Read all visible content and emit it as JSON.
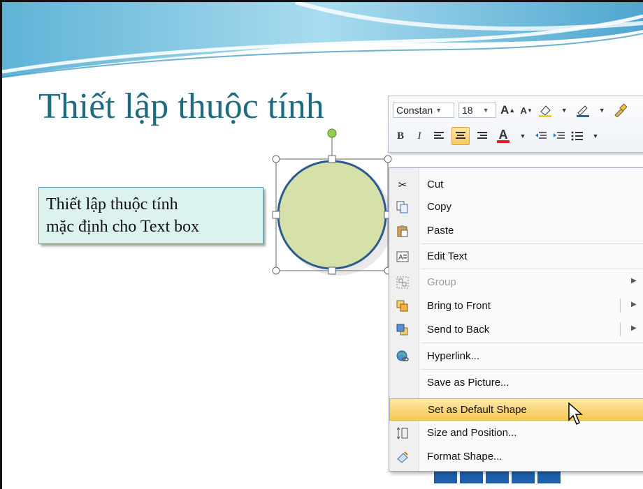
{
  "slide": {
    "title": "Thiết lập thuộc tính",
    "textbox_line1": "Thiết lập thuộc tính",
    "textbox_line2": "mặc định cho Text box"
  },
  "mini_toolbar": {
    "font_name": "Constan",
    "font_size": "18",
    "bold_label": "B",
    "italic_label": "I",
    "font_color_label": "A"
  },
  "context_menu": {
    "items": [
      {
        "label": "Cut",
        "icon": "scissors-icon",
        "enabled": true
      },
      {
        "label": "Copy",
        "icon": "copy-icon",
        "enabled": true
      },
      {
        "label": "Paste",
        "icon": "paste-icon",
        "enabled": true
      },
      {
        "label": "Edit Text",
        "icon": "edit-text-icon",
        "enabled": true
      },
      {
        "label": "Group",
        "icon": "group-icon",
        "enabled": false
      },
      {
        "label": "Bring to Front",
        "icon": "bring-front-icon",
        "enabled": true
      },
      {
        "label": "Send to Back",
        "icon": "send-back-icon",
        "enabled": true
      },
      {
        "label": "Hyperlink...",
        "icon": "hyperlink-icon",
        "enabled": true
      },
      {
        "label": "Save as Picture...",
        "icon": "",
        "enabled": true
      },
      {
        "label": "Set as Default Shape",
        "icon": "",
        "enabled": true,
        "highlighted": true
      },
      {
        "label": "Size and Position...",
        "icon": "size-position-icon",
        "enabled": true
      },
      {
        "label": "Format Shape...",
        "icon": "format-shape-icon",
        "enabled": true
      }
    ]
  },
  "colors": {
    "title": "#1e6b7f",
    "shape_fill": "#d5e1a8",
    "shape_outline": "#2c5a8f",
    "menu_highlight": "#f9c653"
  }
}
